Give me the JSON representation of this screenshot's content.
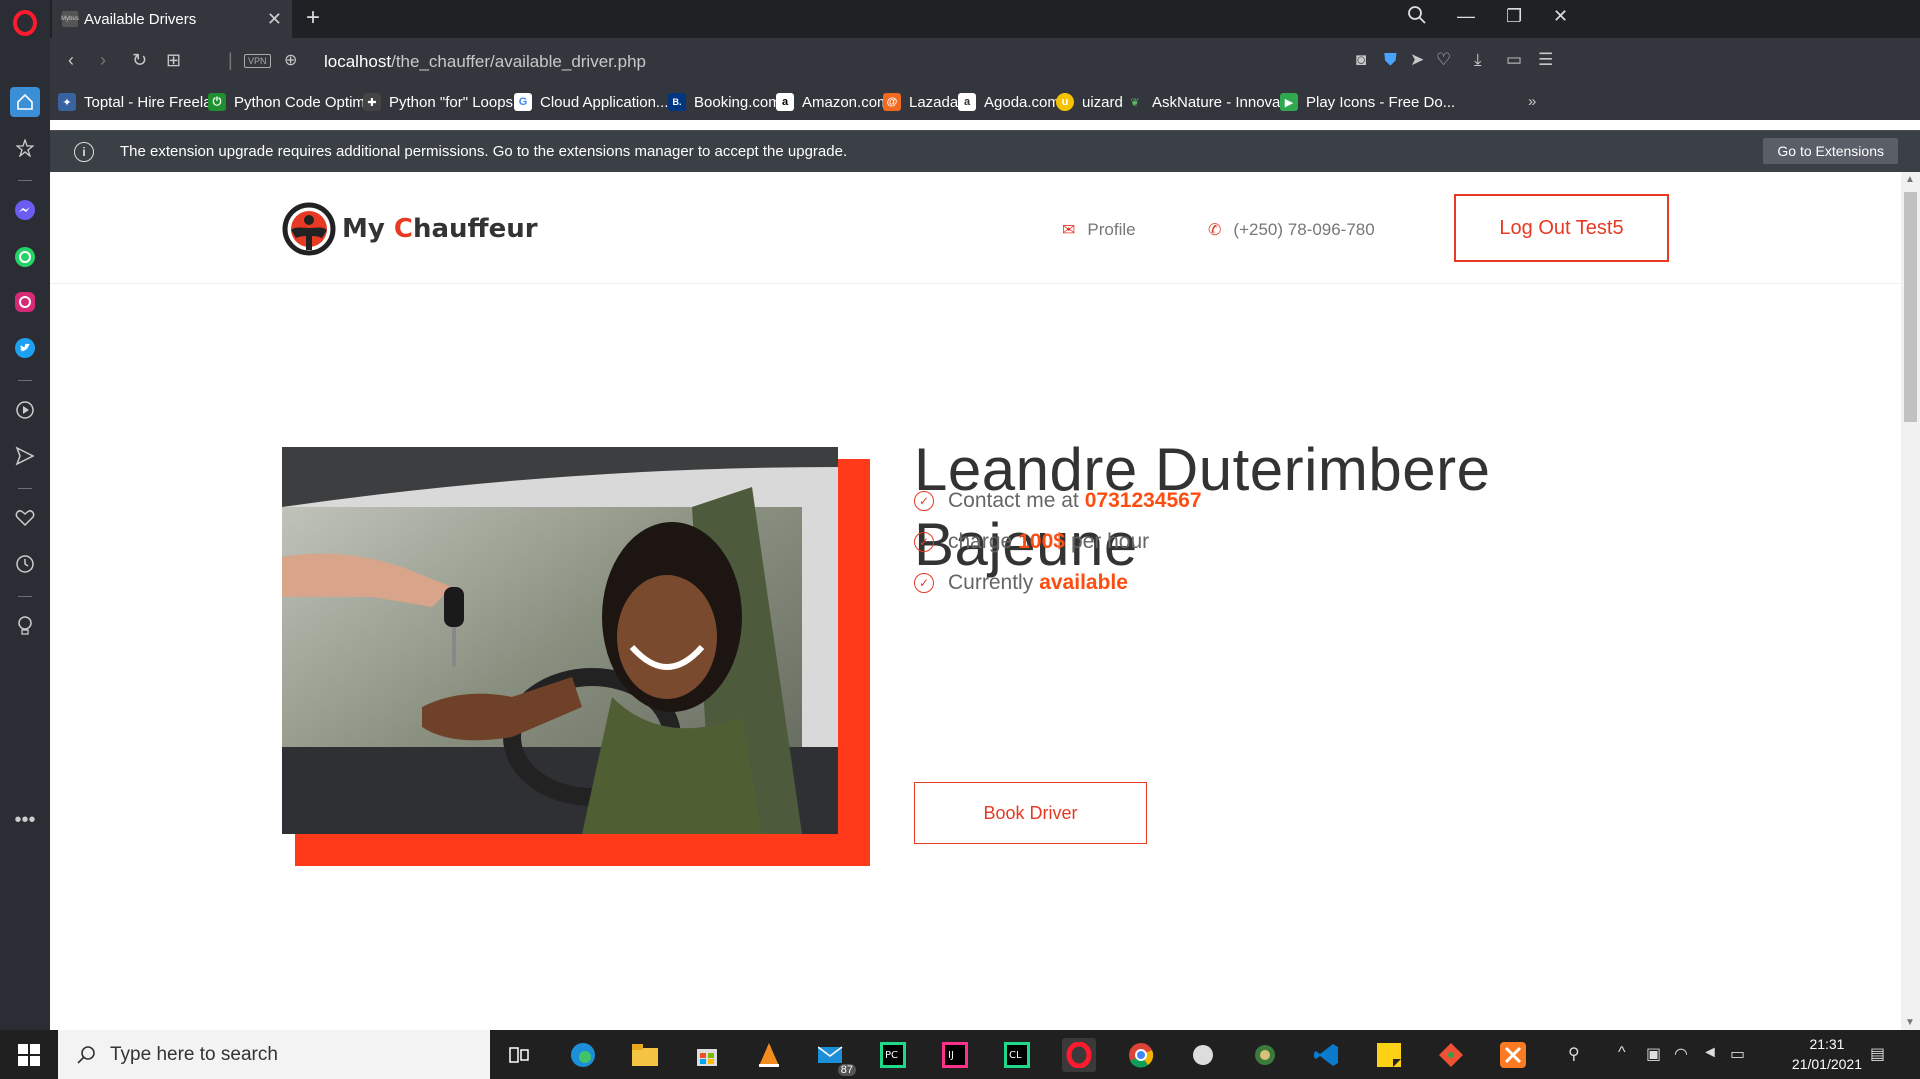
{
  "browser": {
    "tab_title": "Available Drivers",
    "tab_favicon_text": "Mybus",
    "url_host": "localhost",
    "url_path": "/the_chauffer/available_driver.php",
    "vpn_label": "VPN",
    "bookmarks": [
      {
        "label": "Toptal - Hire Freela...",
        "color": "#3863a0",
        "glyph": "✦"
      },
      {
        "label": "Python Code Optim...",
        "color": "#1f8f2f",
        "glyph": "⏻"
      },
      {
        "label": "Python \"for\" Loops...",
        "color": "#444",
        "glyph": "✚"
      },
      {
        "label": "Cloud Application...",
        "color": "#fff",
        "glyph": "G"
      },
      {
        "label": "Booking.com",
        "color": "#003580",
        "glyph": "B."
      },
      {
        "label": "Amazon.com",
        "color": "#fff",
        "glyph": "a"
      },
      {
        "label": "Lazada",
        "color": "#f26a21",
        "glyph": "@"
      },
      {
        "label": "Agoda.com",
        "color": "#fff",
        "glyph": "a"
      },
      {
        "label": "uizard",
        "color": "#f5c400",
        "glyph": "u"
      },
      {
        "label": "AskNature - Innova...",
        "color": "#2c7a2c",
        "glyph": "❦"
      },
      {
        "label": "Play Icons - Free Do...",
        "color": "#2fa84f",
        "glyph": "▶"
      }
    ],
    "infobar": {
      "message": "The extension upgrade requires additional permissions. Go to the extensions manager to accept the upgrade.",
      "button": "Go to Extensions"
    }
  },
  "site": {
    "logo_my": "My ",
    "logo_c": "C",
    "logo_rest": "hauffeur",
    "nav_profile": "Profile",
    "nav_phone": "(+250) 78-096-780",
    "logout": "Log Out Test5",
    "accent": "#e63a24"
  },
  "driver": {
    "name": "Leandre Duterimbere Bajeune",
    "contact_prefix": "Contact me at",
    "contact_value": "0731234567",
    "charge_prefix": "charge",
    "charge_value": "100$",
    "charge_suffix": "per hour",
    "status_prefix": "Currently",
    "status_value": "available",
    "book_button": "Book Driver"
  },
  "taskbar": {
    "search_placeholder": "Type here to search",
    "time": "21:31",
    "date": "21/01/2021",
    "mail_badge": "87"
  }
}
